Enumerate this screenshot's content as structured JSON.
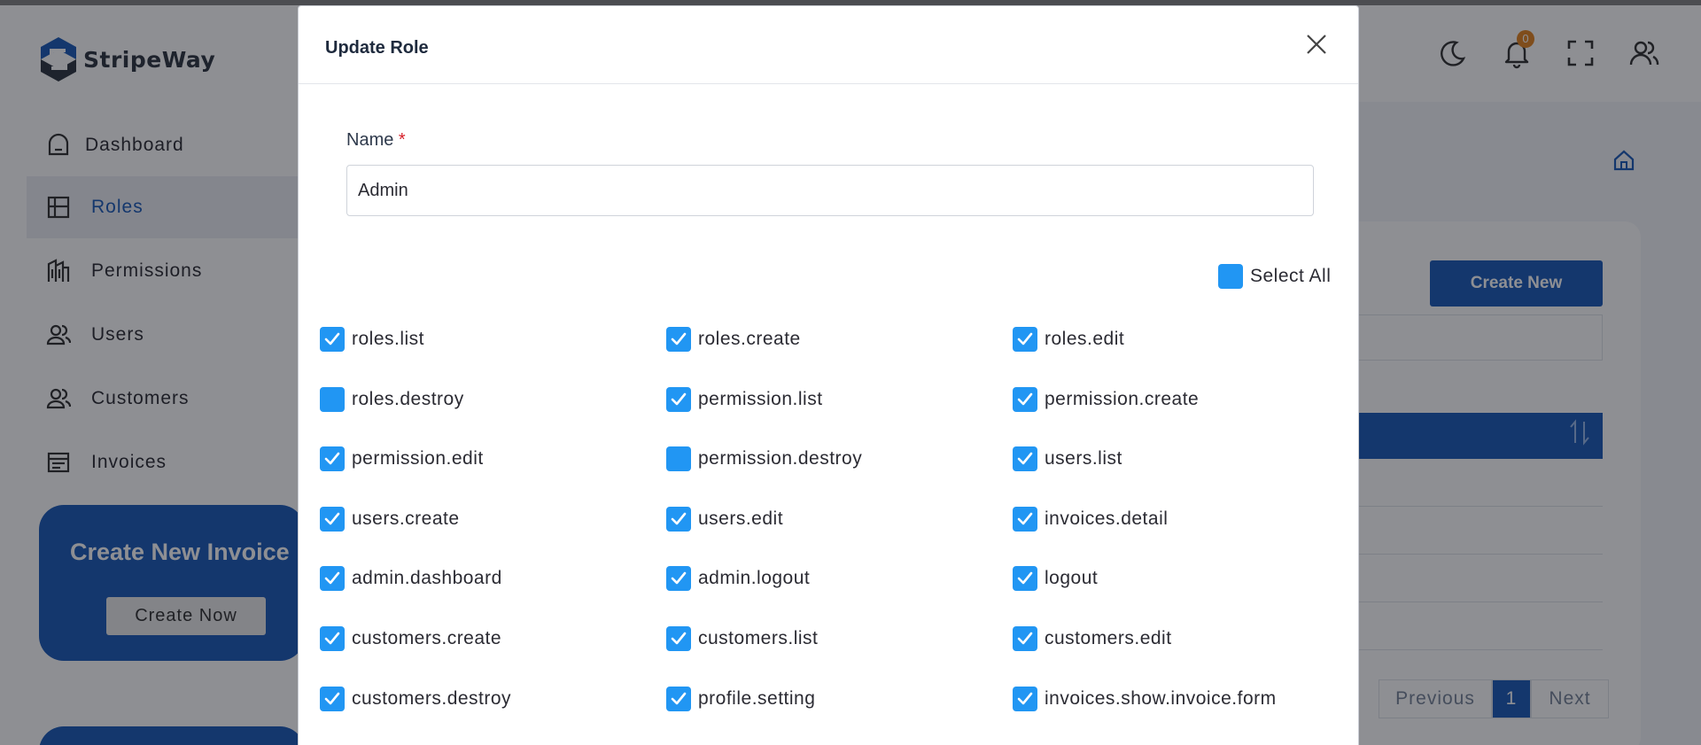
{
  "app": {
    "brand": "StripeWay",
    "notification_count": "0",
    "colors": {
      "primary": "#0b4fb3",
      "checkbox": "#2196f3",
      "badge": "#e07b10",
      "required": "#d6202a"
    }
  },
  "sidebar": {
    "items": [
      {
        "label": "Dashboard",
        "icon": "dashboard-icon",
        "active": false
      },
      {
        "label": "Roles",
        "icon": "grid-icon",
        "active": true
      },
      {
        "label": "Permissions",
        "icon": "building-icon",
        "active": false
      },
      {
        "label": "Users",
        "icon": "users-icon",
        "active": false
      },
      {
        "label": "Customers",
        "icon": "users-icon",
        "active": false
      },
      {
        "label": "Invoices",
        "icon": "invoice-icon",
        "active": false
      }
    ],
    "promo": {
      "title": "Create New Invoice",
      "button": "Create Now"
    }
  },
  "main": {
    "create_new_label": "Create New",
    "pagination": {
      "previous": "Previous",
      "current": "1",
      "next": "Next"
    }
  },
  "modal": {
    "title": "Update Role",
    "name_label": "Name",
    "required_mark": "*",
    "name_value": "Admin",
    "select_all_label": "Select All",
    "select_all_checked": false,
    "permissions": [
      {
        "label": "roles.list",
        "checked": true
      },
      {
        "label": "roles.create",
        "checked": true
      },
      {
        "label": "roles.edit",
        "checked": true
      },
      {
        "label": "roles.destroy",
        "checked": false
      },
      {
        "label": "permission.list",
        "checked": true
      },
      {
        "label": "permission.create",
        "checked": true
      },
      {
        "label": "permission.edit",
        "checked": true
      },
      {
        "label": "permission.destroy",
        "checked": false
      },
      {
        "label": "users.list",
        "checked": true
      },
      {
        "label": "users.create",
        "checked": true
      },
      {
        "label": "users.edit",
        "checked": true
      },
      {
        "label": "invoices.detail",
        "checked": true
      },
      {
        "label": "admin.dashboard",
        "checked": true
      },
      {
        "label": "admin.logout",
        "checked": true
      },
      {
        "label": "logout",
        "checked": true
      },
      {
        "label": "customers.create",
        "checked": true
      },
      {
        "label": "customers.list",
        "checked": true
      },
      {
        "label": "customers.edit",
        "checked": true
      },
      {
        "label": "customers.destroy",
        "checked": true
      },
      {
        "label": "profile.setting",
        "checked": true
      },
      {
        "label": "invoices.show.invoice.form",
        "checked": true
      }
    ]
  }
}
